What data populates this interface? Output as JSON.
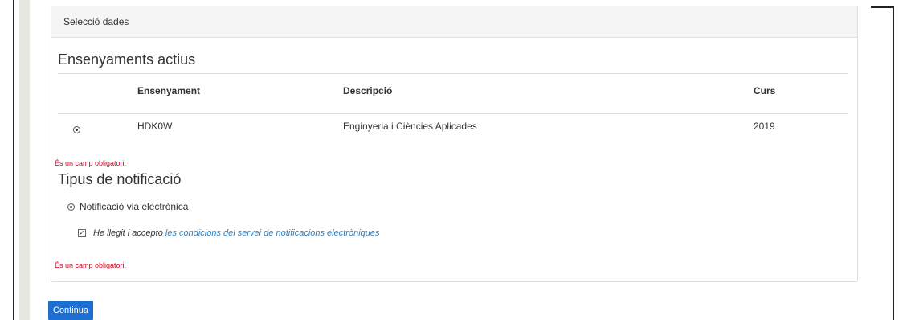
{
  "panel": {
    "heading": "Selecció dades"
  },
  "ensenyaments": {
    "title": "Ensenyaments actius",
    "columns": {
      "ensenyament": "Ensenyament",
      "descripcio": "Descripció",
      "curs": "Curs"
    },
    "rows": [
      {
        "selected": true,
        "ensenyament": "HDK0W",
        "descripcio": "Enginyeria i Ciències Aplicades",
        "curs": "2019"
      }
    ],
    "error": "És un camp obligatori."
  },
  "notificacio": {
    "title": "Tipus de notificació",
    "option_label": "Notificació via electrònica",
    "terms_prefix": "He llegit i accepto ",
    "terms_link": "les condicions del servei de notificacions electròniques",
    "error": "És un camp obligatori."
  },
  "actions": {
    "continue_label": "Continua"
  },
  "colors": {
    "link": "#2a7ec0",
    "error": "#d0021b",
    "primary_button": "#1f6fd1"
  }
}
